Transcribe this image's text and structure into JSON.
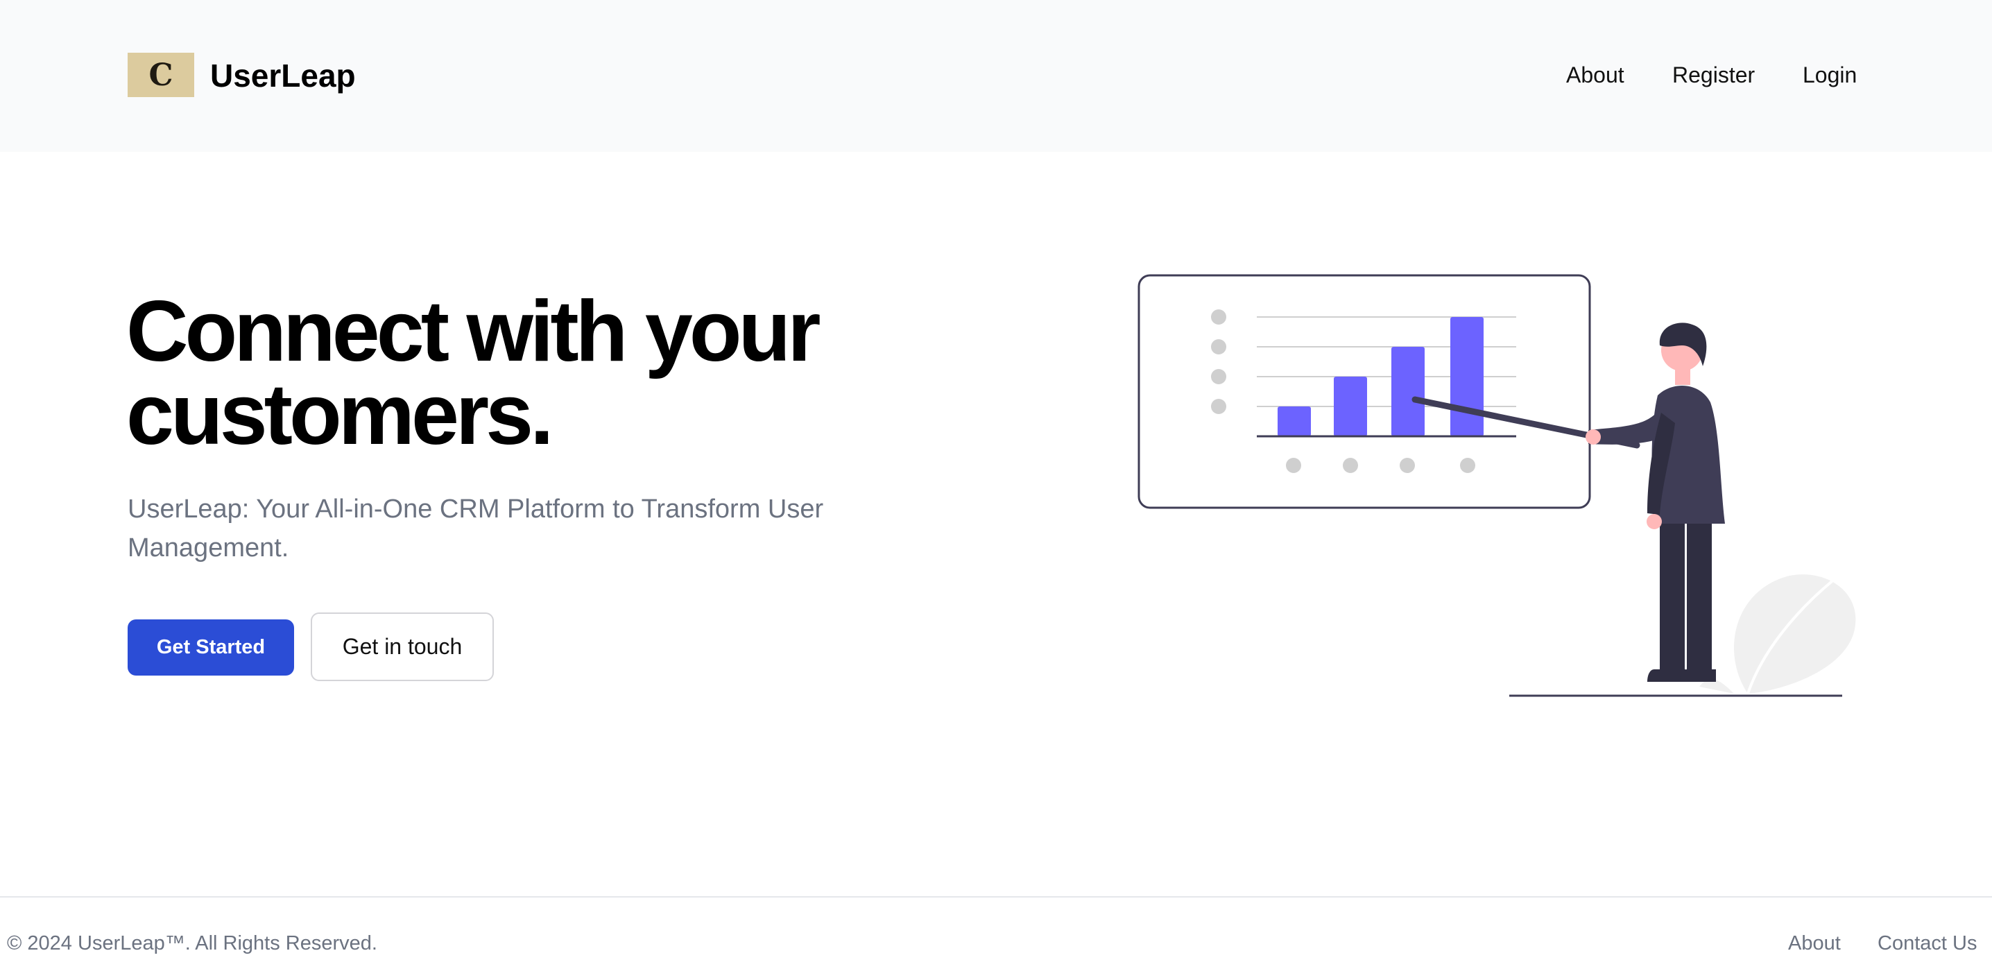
{
  "header": {
    "logo_glyph": "C",
    "brand": "UserLeap",
    "nav": [
      "About",
      "Register",
      "Login"
    ]
  },
  "hero": {
    "title_line1": "Connect with your",
    "title_line2": "customers.",
    "subtitle": "UserLeap: Your All-in-One CRM Platform to Transform User Management.",
    "primary_button": "Get Started",
    "secondary_button": "Get in touch"
  },
  "illustration": {
    "icon": "presentation-chart-illustration",
    "bar_color": "#6c63ff",
    "bar_levels": [
      0.25,
      0.5,
      0.75,
      1.0
    ]
  },
  "footer": {
    "copyright": "© 2024 UserLeap™. All Rights Reserved.",
    "links": [
      "About",
      "Contact Us"
    ]
  },
  "colors": {
    "header_bg": "#f9fafb",
    "primary": "#2b4dd6",
    "logo_bg": "#dccb9e",
    "muted_text": "#6b7280"
  }
}
